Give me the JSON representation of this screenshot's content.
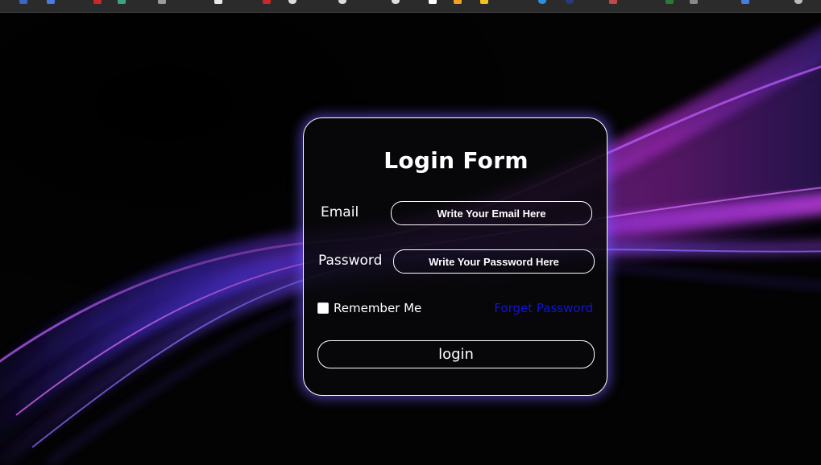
{
  "form": {
    "title": "Login Form",
    "email_label": "Email",
    "email_value": "",
    "email_placeholder": "Write Your Email Here",
    "password_label": "Password",
    "password_value": "",
    "password_placeholder": "Write Your Password Here",
    "remember_label": "Remember Me",
    "remember_checked": false,
    "forget_label": "Forget Password",
    "login_label": "login"
  },
  "colors": {
    "page_background": "#030303",
    "card_border": "#ffffff",
    "card_glow": "#6e5aff",
    "link": "#1212d8",
    "wave_purple": "#b030e8",
    "wave_blue": "#5b3cff"
  },
  "browser": {
    "bookmark_icons": [
      "facebook-icon",
      "docs-icon",
      "youtube-icon",
      "maps-icon",
      "page-icon",
      "page-icon",
      "gmail-icon",
      "github-icon",
      "page-icon",
      "github-icon",
      "page-icon",
      "folder-icon",
      "folder-icon",
      "page-icon",
      "page-icon",
      "page-icon",
      "page-icon",
      "page-icon",
      "page-icon",
      "page-icon",
      "page-icon"
    ]
  }
}
